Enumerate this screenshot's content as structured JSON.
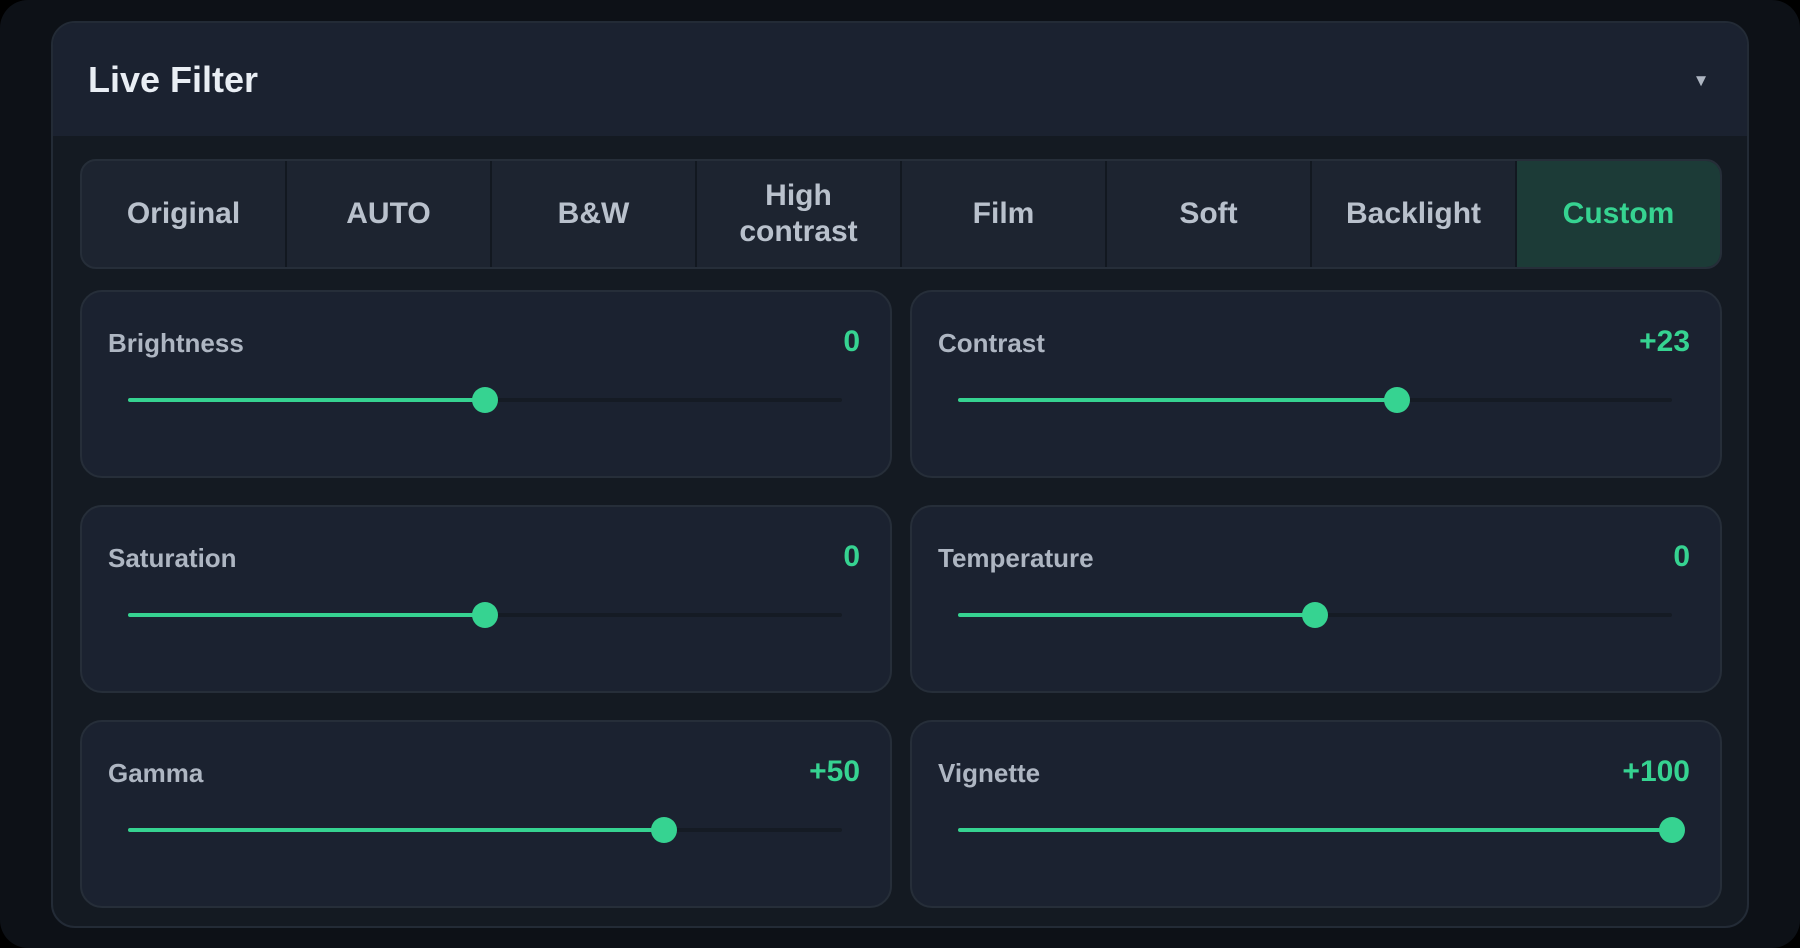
{
  "panel": {
    "title": "Live Filter",
    "collapse_icon": "caret-down-icon",
    "collapse_glyph": "▼"
  },
  "presets": [
    {
      "label": "Original",
      "active": false
    },
    {
      "label": "AUTO",
      "active": false
    },
    {
      "label": "B&W",
      "active": false
    },
    {
      "label": "High contrast",
      "active": false
    },
    {
      "label": "Film",
      "active": false
    },
    {
      "label": "Soft",
      "active": false
    },
    {
      "label": "Backlight",
      "active": false
    },
    {
      "label": "Custom",
      "active": true
    }
  ],
  "adjustments": [
    {
      "name": "brightness",
      "label": "Brightness",
      "value": "0",
      "level": 0.5
    },
    {
      "name": "contrast",
      "label": "Contrast",
      "value": "+23",
      "level": 0.615
    },
    {
      "name": "saturation",
      "label": "Saturation",
      "value": "0",
      "level": 0.5
    },
    {
      "name": "temperature",
      "label": "Temperature",
      "value": "0",
      "level": 0.5
    },
    {
      "name": "gamma",
      "label": "Gamma",
      "value": "+50",
      "level": 0.75
    },
    {
      "name": "vignette",
      "label": "Vignette",
      "value": "+100",
      "level": 1.0
    }
  ],
  "colors": {
    "accent": "#36d391",
    "active_tab_bg": "#1c3b37",
    "card_bg": "#1b2230",
    "panel_bg": "#141a22"
  }
}
